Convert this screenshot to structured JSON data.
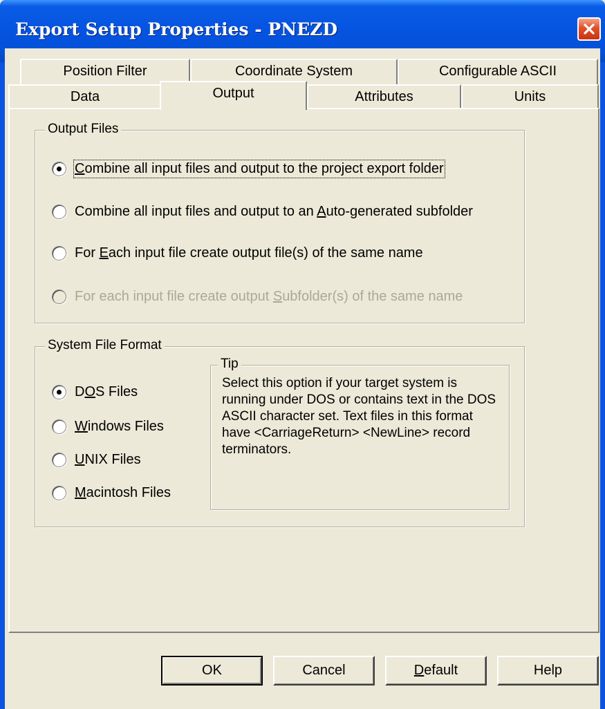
{
  "window": {
    "title": "Export Setup Properties - PNEZD"
  },
  "tabs": {
    "row1": [
      {
        "label": "Position Filter"
      },
      {
        "label": "Coordinate System"
      },
      {
        "label": "Configurable ASCII"
      }
    ],
    "row2": [
      {
        "label": "Data"
      },
      {
        "label": "Output",
        "active": true
      },
      {
        "label": "Attributes"
      },
      {
        "label": "Units"
      }
    ]
  },
  "output_files": {
    "label": "Output Files",
    "options": [
      {
        "pre": "",
        "accel": "C",
        "post": "ombine all input files and output to the project export folder",
        "selected": true,
        "enabled": true
      },
      {
        "pre": "Combine all input files and output to an ",
        "accel": "A",
        "post": "uto-generated subfolder",
        "selected": false,
        "enabled": true
      },
      {
        "pre": "For ",
        "accel": "E",
        "post": "ach input file create output file(s) of the same name",
        "selected": false,
        "enabled": true
      },
      {
        "pre": "For each input file create output ",
        "accel": "S",
        "post": "ubfolder(s) of the same name",
        "selected": false,
        "enabled": false
      }
    ]
  },
  "system_file_format": {
    "label": "System File Format",
    "options": [
      {
        "pre": "D",
        "accel": "O",
        "post": "S Files",
        "selected": true
      },
      {
        "pre": "",
        "accel": "W",
        "post": "indows Files",
        "selected": false
      },
      {
        "pre": "",
        "accel": "U",
        "post": "NIX Files",
        "selected": false
      },
      {
        "pre": "",
        "accel": "M",
        "post": "acintosh Files",
        "selected": false
      }
    ],
    "tip": {
      "label": "Tip",
      "text": "Select this option if your target system is running under DOS or contains text in the DOS ASCII character set. Text files in this format have <CarriageReturn> <NewLine> record terminators."
    }
  },
  "buttons": {
    "ok": "OK",
    "cancel": "Cancel",
    "default_pre": "",
    "default_accel": "D",
    "default_post": "efault",
    "help": "Help"
  }
}
